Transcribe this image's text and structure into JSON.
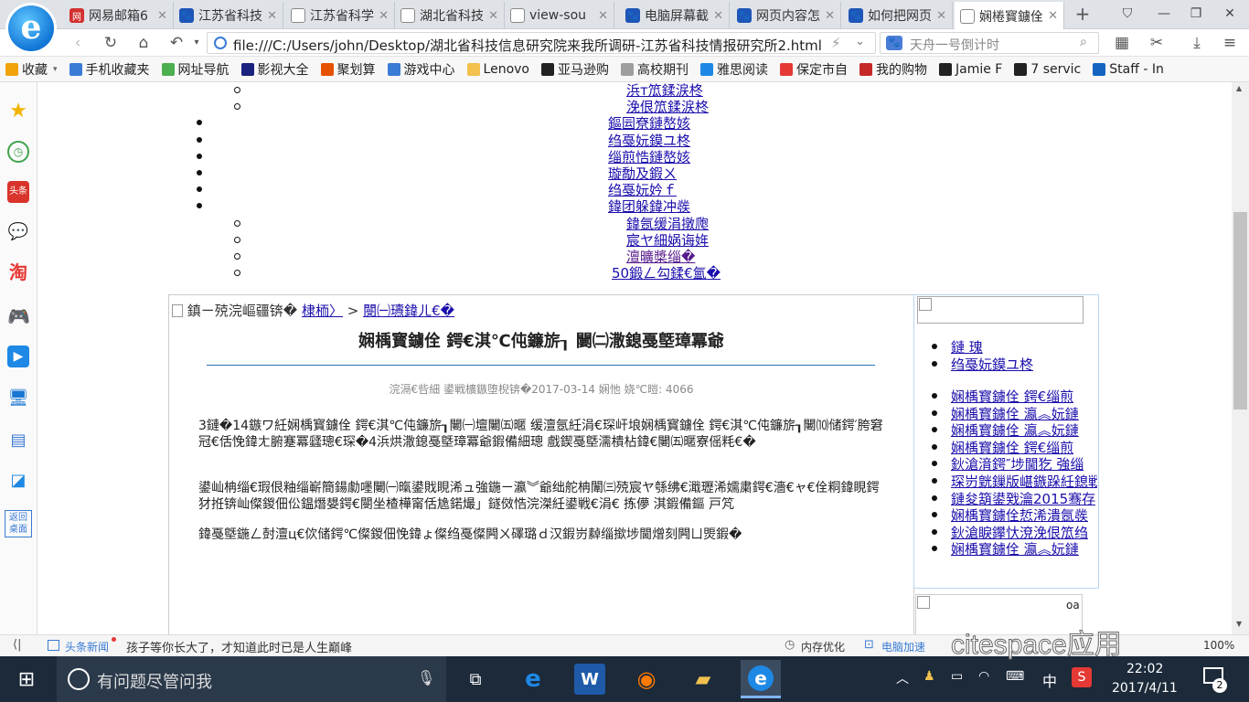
{
  "tabs": [
    {
      "label": "网易邮箱6",
      "color": "#d32f2f",
      "glyph": "网"
    },
    {
      "label": "江苏省科技",
      "color": "#1e56b8",
      "glyph": "🐾"
    },
    {
      "label": "江苏省科学",
      "color": "#888888",
      "glyph": "□"
    },
    {
      "label": "湖北省科技",
      "color": "#888888",
      "glyph": "□"
    },
    {
      "label": "view-sou",
      "color": "#888888",
      "glyph": "□"
    },
    {
      "label": "电脑屏幕截",
      "color": "#1e56b8",
      "glyph": "🐾"
    },
    {
      "label": "网页内容怎",
      "color": "#1e56b8",
      "glyph": "🐾"
    },
    {
      "label": "如何把网页",
      "color": "#1e56b8",
      "glyph": "🐾"
    },
    {
      "label": "娴棬寳鐪佺",
      "color": "#888888",
      "glyph": "□"
    }
  ],
  "address": {
    "url": "file:///C:/Users/john/Desktop/湖北省科技信息研究院来我所调研-江苏省科技情报研究所2.html"
  },
  "search": {
    "placeholder": "天舟一号倒计时"
  },
  "bookmarks": [
    {
      "label": "收藏",
      "color": "#f0a30a"
    },
    {
      "label": "手机收藏夹",
      "color": "#3a7bd5"
    },
    {
      "label": "网址导航",
      "color": "#4caf50"
    },
    {
      "label": "影视大全",
      "color": "#1a237e"
    },
    {
      "label": "聚划算",
      "color": "#e65100"
    },
    {
      "label": "游戏中心",
      "color": "#3a7bd5"
    },
    {
      "label": "Lenovo",
      "color": "#f2c14e"
    },
    {
      "label": "亚马逊购",
      "color": "#222222"
    },
    {
      "label": "高校期刊",
      "color": "#9e9e9e"
    },
    {
      "label": "雅思阅读",
      "color": "#1e88e5"
    },
    {
      "label": "保定市自",
      "color": "#e53935"
    },
    {
      "label": "我的购物",
      "color": "#c62828"
    },
    {
      "label": "Jamie F",
      "color": "#222222"
    },
    {
      "label": "7 servic",
      "color": "#222222"
    },
    {
      "label": "Staff - In",
      "color": "#1565c0"
    }
  ],
  "sidebar_extra": "返回桌面",
  "links_top": [
    {
      "text": "浜т笟鍒涙柊",
      "sub": true
    },
    {
      "text": "浼佷笟鍒涙柊",
      "sub": true
    },
    {
      "text": "鏂囩尞鏈嶅姟",
      "sub": false
    },
    {
      "text": "绉戞妧鏌ユ柊",
      "sub": false
    },
    {
      "text": "缁煎悎鏈嶅姟",
      "sub": false
    },
    {
      "text": "璇勪及鍜ㄨ",
      "sub": false
    },
    {
      "text": "绉戞妧妗ｆ",
      "sub": false
    },
    {
      "text": "鍏团躲鍏冲彂",
      "sub": false
    },
    {
      "text": "鍏氬缓涓撴爮",
      "sub": true
    },
    {
      "text": "宸ヤ細娲诲姩",
      "sub": true
    },
    {
      "text": "澶曠槳缁�",
      "sub": true
    },
    {
      "text": "50鍛ㄥ勾鍒€氳�",
      "sub": true
    }
  ],
  "article": {
    "breadcrumb_prefix": "鎮ㄧ殑浣嶇疆锛�",
    "breadcrumb_link1": "棣栭〉",
    "breadcrumb_sep": ">",
    "breadcrumb_link2": "閿㈠瓙鍏ㄦ€�",
    "title": "娴楀寳鐪佺   鍔€淇℃伅鐮旂┒ 闄㈡潵鎴戞墍璋冪爺",
    "meta": "浣滆€呰細 鍙戦櫎鏃堕棿锛�2017-03-14  娴忚   娆℃暟: 4066",
    "p1": "3鏈�14鏃ワ紝娴楀寳鐪佺   鍔€淇℃伅鐮旂┒闄㈠壇闄㈤暱   缓澶氬紝涓€琛屽埌娴楀寳鐪佺   鍔€淇℃伅鐮旂┒闄⑽储鍔′胯窘冠€佸悗鍏ㄤ腑蹇冪瓥璁€琛�4浜烘潵鎴戞墍璋冪爺鍜備細璁   戲鍥戞墍濡樻枮鍏€闄㈤暱寮傜粍€�",
    "p2": "鍙屾柟缁€瑕佷粙缁嶄簡鍚勮嚜闄㈠暣鍙戝睍浠ュ強鍦ㄧ瀛︾爺绌舵柟闈㈢殑宸ヤ綔绋€濈瓑浠嬬粛鍔€濇€ャ€佺粡鍏睍鍔犲拰锛屾儏鍐佃伀鎾熸嫢鍔€閿坐楂樺甯佸尯鍩熶」鐩傚悎浣滐紝鍙戦€涓€ 拣儚 淇鍜備鏂  戸竼",
    "p3": "鍏戞墍鍦ㄥ尌澶ц€佽储鍔℃儏鍐佃悗鍏ょ儏绉戞儏闁ㄨ礋璐ｄ汉鍜岃繛缁撳埗閫熷刻闁ㄩ煚鍜�"
  },
  "right_links_a": [
    "鏈   瑰",
    "绉戞妧鏌ユ柊"
  ],
  "right_links_b": [
    "娴楀寳鐪佺   鍔€缁煎",
    "娴楀寳鐪佺   瀛︽妧鏈",
    "娴楀寳鐪佺   瀛︽妧鏈",
    "娴楀寳鐪佺   鍔€缁煎",
    "鈥滄湇鍔″埗閫犵   強缁",
    "琛岃皝鏁版嵁鏃跺紝鎴戦",
    "鏈夋箶鍙戣瀹2015骞存",
    "娴楀寳鐪佺悊浠潰氬彂",
    "鈥滄睙鑻忕渷浼佷笟绉",
    "娴楀寳鐪佺   瀛︽妧鏈"
  ],
  "right_box2_text": "oa",
  "status": {
    "news_label": "头条新闻",
    "news_text": "孩子等你长大了，才知道此时已是人生巅峰",
    "mem": "内存优化",
    "speed": "电脑加速",
    "zoom": "100%"
  },
  "taskbar": {
    "search_placeholder": "有问题尽管问我",
    "ime": "中",
    "time": "22:02",
    "date": "2017/4/11",
    "notif_count": "2"
  },
  "watermark": "citespace应用"
}
